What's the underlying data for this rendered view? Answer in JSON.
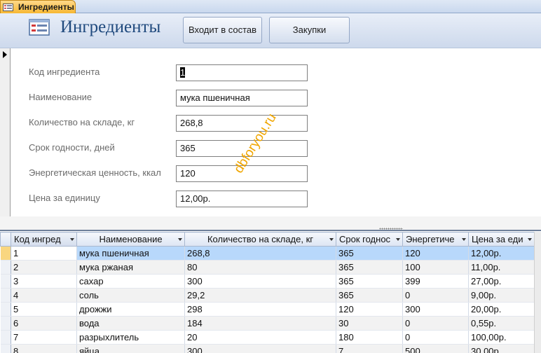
{
  "tab": {
    "label": "Ингредиенты",
    "icon": "form-icon"
  },
  "header": {
    "title": "Ингредиенты",
    "buttons": {
      "included_in": "Входит в состав",
      "purchases": "Закупки"
    }
  },
  "form": {
    "fields": [
      {
        "label": "Код ингредиента",
        "value": "1"
      },
      {
        "label": "Наименование",
        "value": "мука пшеничная"
      },
      {
        "label": "Количество на складе, кг",
        "value": "268,8"
      },
      {
        "label": "Срок годности, дней",
        "value": "365"
      },
      {
        "label": "Энергетическая ценность, ккал",
        "value": "120"
      },
      {
        "label": "Цена за единицу",
        "value": "12,00р."
      }
    ]
  },
  "watermark": "dbforyou.ru",
  "datasheet": {
    "columns": [
      "Код ингред",
      "Наименование",
      "Количество на складе, кг",
      "Срок годнос",
      "Энергетиче",
      "Цена за еди"
    ],
    "rows": [
      [
        "1",
        "мука пшеничная",
        "268,8",
        "365",
        "120",
        "12,00р."
      ],
      [
        "2",
        "мука ржаная",
        "80",
        "365",
        "100",
        "11,00р."
      ],
      [
        "3",
        "сахар",
        "300",
        "365",
        "399",
        "27,00р."
      ],
      [
        "4",
        "соль",
        "29,2",
        "365",
        "0",
        "9,00р."
      ],
      [
        "5",
        "дрожжи",
        "298",
        "120",
        "300",
        "20,00р."
      ],
      [
        "6",
        "вода",
        "184",
        "30",
        "0",
        "0,55р."
      ],
      [
        "7",
        "разрыхлитель",
        "20",
        "180",
        "0",
        "100,00р."
      ],
      [
        "8",
        "яйца",
        "300",
        "7",
        "500",
        "30,00р."
      ]
    ]
  },
  "colors": {
    "title": "#1f497d",
    "tab": "#f7b733",
    "selected_row": "#b8d8fb",
    "watermark": "#f0a600"
  }
}
